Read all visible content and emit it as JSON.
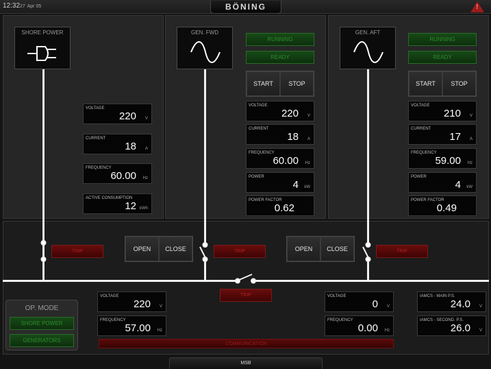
{
  "topbar": {
    "time": "12:32",
    "seconds": "27",
    "date": "Apr 05",
    "brand": "BÖNING"
  },
  "shore": {
    "title": "SHORE POWER",
    "voltage": {
      "label": "VOLTAGE",
      "value": "220",
      "unit": "V"
    },
    "current": {
      "label": "CURRENT",
      "value": "18",
      "unit": "A"
    },
    "frequency": {
      "label": "FREQUENCY",
      "value": "60.00",
      "unit": "Hz"
    },
    "active": {
      "label": "ACTIVE CONSUMPTION",
      "value": "12",
      "unit": "kWh"
    },
    "trip": "TRIP"
  },
  "gen_fwd": {
    "title": "GEN. FWD",
    "running": "RUNNING",
    "ready": "READY",
    "start": "START",
    "stop": "STOP",
    "voltage": {
      "label": "VOLTAGE",
      "value": "220",
      "unit": "V"
    },
    "current": {
      "label": "CURRENT",
      "value": "18",
      "unit": "A"
    },
    "frequency": {
      "label": "FREQUENCY",
      "value": "60.00",
      "unit": "Hz"
    },
    "power": {
      "label": "POWER",
      "value": "4",
      "unit": "kW"
    },
    "pf": {
      "label": "POWER FACTOR",
      "value": "0.62",
      "unit": ""
    },
    "open": "OPEN",
    "close": "CLOSE",
    "trip": "TRIP"
  },
  "gen_aft": {
    "title": "GEN. AFT",
    "running": "RUNNING",
    "ready": "READY",
    "start": "START",
    "stop": "STOP",
    "voltage": {
      "label": "VOLTAGE",
      "value": "210",
      "unit": "V"
    },
    "current": {
      "label": "CURRENT",
      "value": "17",
      "unit": "A"
    },
    "frequency": {
      "label": "FREQUENCY",
      "value": "59.00",
      "unit": "Hz"
    },
    "power": {
      "label": "POWER",
      "value": "4",
      "unit": "kW"
    },
    "pf": {
      "label": "POWER FACTOR",
      "value": "0.49",
      "unit": ""
    },
    "open": "OPEN",
    "close": "CLOSE",
    "trip": "TRIP"
  },
  "bus": {
    "left_voltage": {
      "label": "VOLTAGE",
      "value": "220",
      "unit": "V"
    },
    "left_frequency": {
      "label": "FREQUENCY",
      "value": "57.00",
      "unit": "Hz"
    },
    "right_voltage": {
      "label": "VOLTAGE",
      "value": "0",
      "unit": "V"
    },
    "right_frequency": {
      "label": "FREQUENCY",
      "value": "0.00",
      "unit": "Hz"
    },
    "iamcs_main": {
      "label": "IAMCS - MAIN P.S.",
      "value": "24.0",
      "unit": "V"
    },
    "iamcs_second": {
      "label": "IAMCS - SECOND. P.S.",
      "value": "26.0",
      "unit": "V"
    },
    "trip": "TRIP"
  },
  "opmode": {
    "title": "OP. MODE",
    "shore": "SHORE POWER",
    "generators": "GENERATORS"
  },
  "comm": "COMMUNICATION",
  "tab": "MSB",
  "colors": {
    "status_green": "#2e8a2e",
    "trip_red": "#b02020",
    "background": "#141414"
  },
  "icons": {
    "shore": "plug-icon",
    "gen": "sine-wave-icon",
    "warning": "warning-triangle-icon"
  }
}
